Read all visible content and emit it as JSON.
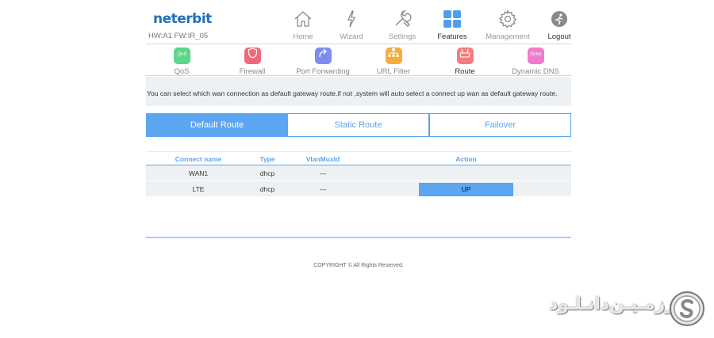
{
  "header": {
    "logo": "neterbit",
    "hw_fw": "HW:A1 FW:IR_05"
  },
  "topnav": [
    {
      "label": "Home",
      "icon": "home-icon"
    },
    {
      "label": "Wizard",
      "icon": "wizard-icon"
    },
    {
      "label": "Settings",
      "icon": "wrench-icon"
    },
    {
      "label": "Features",
      "icon": "grid-icon",
      "active": true
    },
    {
      "label": "Management",
      "icon": "gear-icon"
    },
    {
      "label": "Logout",
      "icon": "logout-icon"
    }
  ],
  "subnav": [
    {
      "label": "QoS",
      "icon_text": "QoS",
      "color": "#5cd68a"
    },
    {
      "label": "Firewall",
      "color": "#f2677a"
    },
    {
      "label": "Port Forwarding",
      "color": "#7d8cf0"
    },
    {
      "label": "URL Filter",
      "color": "#f5ac3c"
    },
    {
      "label": "Route",
      "color": "#f47c7c",
      "active": true
    },
    {
      "label": "Dynamic DNS",
      "icon_text": "DDNS",
      "color": "#f07ccf"
    }
  ],
  "info": "You can select which wan connection as default gateway route.if not ,system will auto select a connect up wan as default gateway route.",
  "tabs": [
    {
      "label": "Default Route",
      "active": true
    },
    {
      "label": "Static Route"
    },
    {
      "label": "Failover"
    }
  ],
  "table": {
    "headers": {
      "name": "Connect name",
      "type": "Type",
      "vlan": "VlanMuxId",
      "action": "Action"
    },
    "rows": [
      {
        "name": "WAN1",
        "type": "dhcp",
        "vlan": "---",
        "action": ""
      },
      {
        "name": "LTE",
        "type": "dhcp",
        "vlan": "---",
        "action": "UP"
      }
    ]
  },
  "footer": {
    "copyright": "COPYRIGHT © All Rights Reserved."
  },
  "watermark": {
    "text": "سـرزمـیـن‌دانـلـود"
  },
  "colors": {
    "accent": "#5ba5f1",
    "brand": "#1f6fb8",
    "band": "#eef1f4"
  }
}
